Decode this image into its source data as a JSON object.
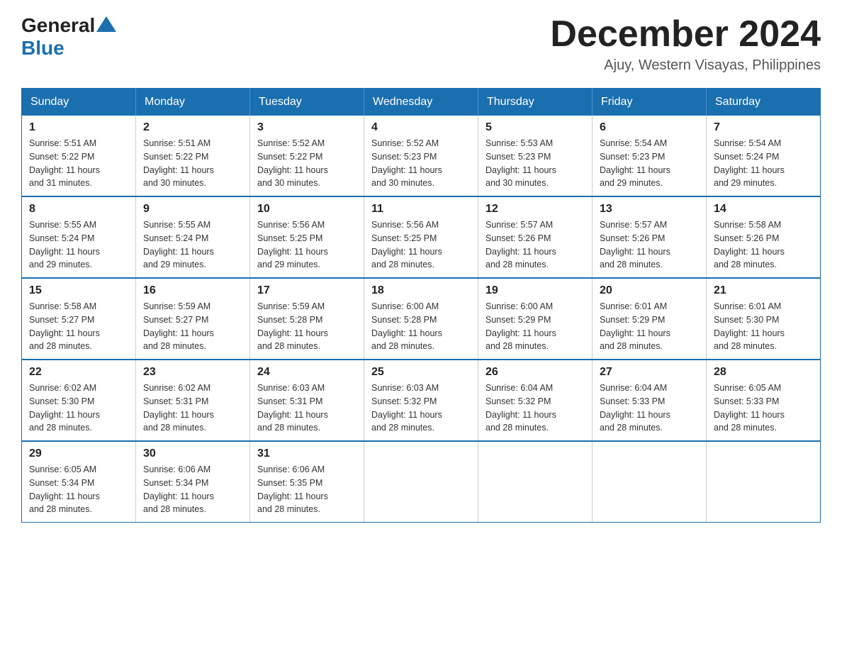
{
  "logo": {
    "general": "General",
    "blue": "Blue"
  },
  "header": {
    "month_year": "December 2024",
    "location": "Ajuy, Western Visayas, Philippines"
  },
  "days_of_week": [
    "Sunday",
    "Monday",
    "Tuesday",
    "Wednesday",
    "Thursday",
    "Friday",
    "Saturday"
  ],
  "weeks": [
    [
      {
        "day": "1",
        "sunrise": "5:51 AM",
        "sunset": "5:22 PM",
        "daylight": "11 hours and 31 minutes."
      },
      {
        "day": "2",
        "sunrise": "5:51 AM",
        "sunset": "5:22 PM",
        "daylight": "11 hours and 30 minutes."
      },
      {
        "day": "3",
        "sunrise": "5:52 AM",
        "sunset": "5:22 PM",
        "daylight": "11 hours and 30 minutes."
      },
      {
        "day": "4",
        "sunrise": "5:52 AM",
        "sunset": "5:23 PM",
        "daylight": "11 hours and 30 minutes."
      },
      {
        "day": "5",
        "sunrise": "5:53 AM",
        "sunset": "5:23 PM",
        "daylight": "11 hours and 30 minutes."
      },
      {
        "day": "6",
        "sunrise": "5:54 AM",
        "sunset": "5:23 PM",
        "daylight": "11 hours and 29 minutes."
      },
      {
        "day": "7",
        "sunrise": "5:54 AM",
        "sunset": "5:24 PM",
        "daylight": "11 hours and 29 minutes."
      }
    ],
    [
      {
        "day": "8",
        "sunrise": "5:55 AM",
        "sunset": "5:24 PM",
        "daylight": "11 hours and 29 minutes."
      },
      {
        "day": "9",
        "sunrise": "5:55 AM",
        "sunset": "5:24 PM",
        "daylight": "11 hours and 29 minutes."
      },
      {
        "day": "10",
        "sunrise": "5:56 AM",
        "sunset": "5:25 PM",
        "daylight": "11 hours and 29 minutes."
      },
      {
        "day": "11",
        "sunrise": "5:56 AM",
        "sunset": "5:25 PM",
        "daylight": "11 hours and 28 minutes."
      },
      {
        "day": "12",
        "sunrise": "5:57 AM",
        "sunset": "5:26 PM",
        "daylight": "11 hours and 28 minutes."
      },
      {
        "day": "13",
        "sunrise": "5:57 AM",
        "sunset": "5:26 PM",
        "daylight": "11 hours and 28 minutes."
      },
      {
        "day": "14",
        "sunrise": "5:58 AM",
        "sunset": "5:26 PM",
        "daylight": "11 hours and 28 minutes."
      }
    ],
    [
      {
        "day": "15",
        "sunrise": "5:58 AM",
        "sunset": "5:27 PM",
        "daylight": "11 hours and 28 minutes."
      },
      {
        "day": "16",
        "sunrise": "5:59 AM",
        "sunset": "5:27 PM",
        "daylight": "11 hours and 28 minutes."
      },
      {
        "day": "17",
        "sunrise": "5:59 AM",
        "sunset": "5:28 PM",
        "daylight": "11 hours and 28 minutes."
      },
      {
        "day": "18",
        "sunrise": "6:00 AM",
        "sunset": "5:28 PM",
        "daylight": "11 hours and 28 minutes."
      },
      {
        "day": "19",
        "sunrise": "6:00 AM",
        "sunset": "5:29 PM",
        "daylight": "11 hours and 28 minutes."
      },
      {
        "day": "20",
        "sunrise": "6:01 AM",
        "sunset": "5:29 PM",
        "daylight": "11 hours and 28 minutes."
      },
      {
        "day": "21",
        "sunrise": "6:01 AM",
        "sunset": "5:30 PM",
        "daylight": "11 hours and 28 minutes."
      }
    ],
    [
      {
        "day": "22",
        "sunrise": "6:02 AM",
        "sunset": "5:30 PM",
        "daylight": "11 hours and 28 minutes."
      },
      {
        "day": "23",
        "sunrise": "6:02 AM",
        "sunset": "5:31 PM",
        "daylight": "11 hours and 28 minutes."
      },
      {
        "day": "24",
        "sunrise": "6:03 AM",
        "sunset": "5:31 PM",
        "daylight": "11 hours and 28 minutes."
      },
      {
        "day": "25",
        "sunrise": "6:03 AM",
        "sunset": "5:32 PM",
        "daylight": "11 hours and 28 minutes."
      },
      {
        "day": "26",
        "sunrise": "6:04 AM",
        "sunset": "5:32 PM",
        "daylight": "11 hours and 28 minutes."
      },
      {
        "day": "27",
        "sunrise": "6:04 AM",
        "sunset": "5:33 PM",
        "daylight": "11 hours and 28 minutes."
      },
      {
        "day": "28",
        "sunrise": "6:05 AM",
        "sunset": "5:33 PM",
        "daylight": "11 hours and 28 minutes."
      }
    ],
    [
      {
        "day": "29",
        "sunrise": "6:05 AM",
        "sunset": "5:34 PM",
        "daylight": "11 hours and 28 minutes."
      },
      {
        "day": "30",
        "sunrise": "6:06 AM",
        "sunset": "5:34 PM",
        "daylight": "11 hours and 28 minutes."
      },
      {
        "day": "31",
        "sunrise": "6:06 AM",
        "sunset": "5:35 PM",
        "daylight": "11 hours and 28 minutes."
      },
      null,
      null,
      null,
      null
    ]
  ],
  "labels": {
    "sunrise": "Sunrise:",
    "sunset": "Sunset:",
    "daylight": "Daylight:"
  }
}
